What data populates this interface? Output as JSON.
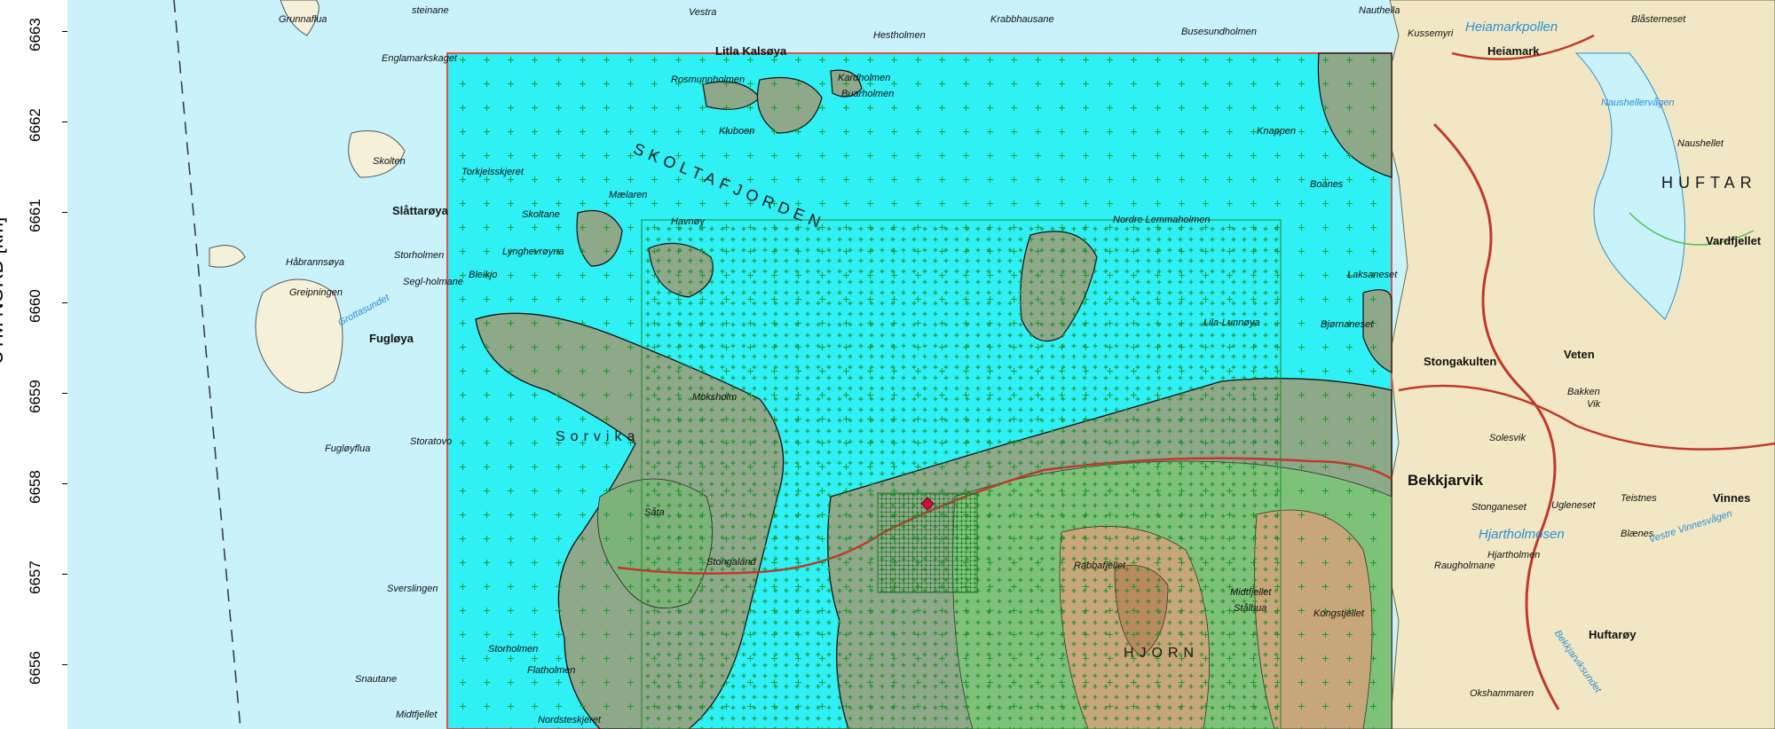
{
  "y_axis": {
    "title": "UTM NORD [km]",
    "ticks": [
      "6663",
      "6662",
      "6661",
      "6660",
      "6659",
      "6658",
      "6657",
      "6656"
    ]
  },
  "map_labels": [
    {
      "text": "Grunnaflua",
      "kind": "place"
    },
    {
      "text": "steinane",
      "kind": "place"
    },
    {
      "text": "Vestra",
      "kind": "place"
    },
    {
      "text": "Hestholmen",
      "kind": "place"
    },
    {
      "text": "Krabbhausane",
      "kind": "place"
    },
    {
      "text": "Busesundholmen",
      "kind": "place"
    },
    {
      "text": "Nauthella",
      "kind": "place"
    },
    {
      "text": "Kussemyri",
      "kind": "place"
    },
    {
      "text": "Heiamarkpollen",
      "kind": "water"
    },
    {
      "text": "Heiamark",
      "kind": "bold"
    },
    {
      "text": "Blåsterneset",
      "kind": "place"
    },
    {
      "text": "Englamarkskaget",
      "kind": "place"
    },
    {
      "text": "Litla Kalsøya",
      "kind": "place"
    },
    {
      "text": "Rosmunnholmen",
      "kind": "place"
    },
    {
      "text": "Kardholmen",
      "kind": "place"
    },
    {
      "text": "Buarholmen",
      "kind": "place"
    },
    {
      "text": "Kluboen",
      "kind": "place"
    },
    {
      "text": "Skolten",
      "kind": "place"
    },
    {
      "text": "Torkjelsskjeret",
      "kind": "place"
    },
    {
      "text": "SKOLTAFJORDEN",
      "kind": "water"
    },
    {
      "text": "Knappen",
      "kind": "place"
    },
    {
      "text": "Boanes",
      "kind": "place"
    },
    {
      "text": "Slåttarøya",
      "kind": "bold"
    },
    {
      "text": "Skoltane",
      "kind": "place"
    },
    {
      "text": "Mælaren",
      "kind": "place"
    },
    {
      "text": "Havnøy",
      "kind": "place"
    },
    {
      "text": "Nordre Lemmaholmen",
      "kind": "place"
    },
    {
      "text": "Storholmen",
      "kind": "place"
    },
    {
      "text": "Lynghevrøyna",
      "kind": "place"
    },
    {
      "text": "Håbrannsøya",
      "kind": "place"
    },
    {
      "text": "Segl-holmane",
      "kind": "place"
    },
    {
      "text": "Greipningen",
      "kind": "place"
    },
    {
      "text": "Bleikjo",
      "kind": "place"
    },
    {
      "text": "Laksaneset",
      "kind": "place"
    },
    {
      "text": "Grottasundet",
      "kind": "water"
    },
    {
      "text": "Fugløya",
      "kind": "bold"
    },
    {
      "text": "Bjørnaneset",
      "kind": "place"
    },
    {
      "text": "Lila-Lunnøya",
      "kind": "place"
    },
    {
      "text": "Stongakulten",
      "kind": "bold"
    },
    {
      "text": "Veten",
      "kind": "bold"
    },
    {
      "text": "Storatovo",
      "kind": "place"
    },
    {
      "text": "Fugløyflua",
      "kind": "place"
    },
    {
      "text": "Sorvika",
      "kind": "water"
    },
    {
      "text": "Moksholm",
      "kind": "place"
    },
    {
      "text": "Bekkjarvik",
      "kind": "bold"
    },
    {
      "text": "Stonganeset",
      "kind": "place"
    },
    {
      "text": "Ugleneset",
      "kind": "place"
    },
    {
      "text": "Teistnes",
      "kind": "place"
    },
    {
      "text": "Vinnes",
      "kind": "bold"
    },
    {
      "text": "Hjartholmosen",
      "kind": "water"
    },
    {
      "text": "Hjartholmen",
      "kind": "place"
    },
    {
      "text": "Blænes",
      "kind": "place"
    },
    {
      "text": "Såta",
      "kind": "place"
    },
    {
      "text": "Stongaland",
      "kind": "place"
    },
    {
      "text": "Raugholmane",
      "kind": "place"
    },
    {
      "text": "Sverslingen",
      "kind": "place"
    },
    {
      "text": "Rabbafjellet",
      "kind": "place"
    },
    {
      "text": "Midtfjellet",
      "kind": "place"
    },
    {
      "text": "Kongstjellet",
      "kind": "place"
    },
    {
      "text": "Stålhua",
      "kind": "place"
    },
    {
      "text": "HJORN",
      "kind": "large"
    },
    {
      "text": "Huftarøy",
      "kind": "bold"
    },
    {
      "text": "HUFTAR",
      "kind": "large"
    },
    {
      "text": "Storholmen",
      "kind": "place"
    },
    {
      "text": "Flatholmen",
      "kind": "place"
    },
    {
      "text": "Snautane",
      "kind": "place"
    },
    {
      "text": "Okshammaren",
      "kind": "place"
    },
    {
      "text": "Midtfjellet",
      "kind": "place"
    },
    {
      "text": "Nordsteskjeret",
      "kind": "place"
    },
    {
      "text": "Vardfjellet",
      "kind": "place"
    },
    {
      "text": "Naushellervågen",
      "kind": "water"
    },
    {
      "text": "Naushellet",
      "kind": "place"
    },
    {
      "text": "Bekkjarviksundet",
      "kind": "water"
    },
    {
      "text": "Solesvik",
      "kind": "place"
    },
    {
      "text": "Bakken",
      "kind": "place"
    },
    {
      "text": "Vik",
      "kind": "place"
    },
    {
      "text": "Vestre Vinnesvågen",
      "kind": "water"
    }
  ],
  "colors": {
    "sea": "#c9f2fb",
    "domain_sea": "#2ff0f5",
    "land_low": "#8ea88a",
    "land_mid": "#7ec27a",
    "land_high": "#c7a679",
    "grid": "#1a9a2a",
    "road": "#c0392b",
    "domain_border": "#e05050",
    "point": "#d0103a"
  }
}
